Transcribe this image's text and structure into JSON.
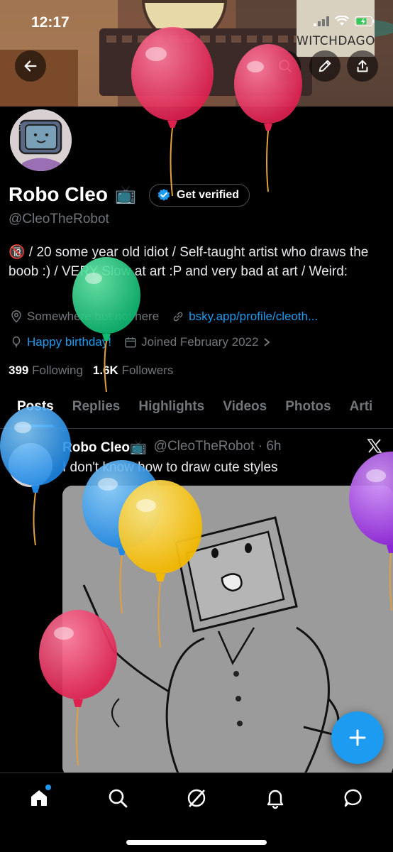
{
  "status_bar": {
    "time": "12:17"
  },
  "banner": {
    "poster_text": "WITCHDAGO"
  },
  "profile": {
    "display_name": "Robo Cleo",
    "display_name_emoji": "📺",
    "get_verified_label": "Get verified",
    "handle": "@CleoTheRobot",
    "bio": "🔞 / 20 some year old idiot / Self-taught artist who draws the boob :) / VERY Slow at art :P and very bad at art / Weird:",
    "location": "Somewhere but not here",
    "website": "bsky.app/profile/cleoth...",
    "birthday": "Happy birthday!",
    "joined": "Joined February 2022",
    "following_count": "399",
    "following_label": "Following",
    "followers_count": "1.6K",
    "followers_label": "Followers"
  },
  "tabs": [
    "Posts",
    "Replies",
    "Highlights",
    "Videos",
    "Photos",
    "Arti"
  ],
  "post": {
    "author_name": "Robo Cleo📺",
    "author_handle": "@CleoTheRobot · 6h",
    "text": "I don't know how to draw cute styles"
  },
  "icons": {
    "back": "back-arrow-icon",
    "search": "search-icon",
    "edit": "pencil-icon",
    "share": "share-icon",
    "location": "location-pin-icon",
    "link": "link-icon",
    "balloon": "balloon-icon",
    "calendar": "calendar-icon",
    "compose": "plus-icon",
    "nav": [
      "home-icon",
      "search-icon",
      "grok-icon",
      "bell-icon",
      "messages-icon"
    ]
  },
  "colors": {
    "accent": "#1d9bf0",
    "muted": "#71767b"
  }
}
